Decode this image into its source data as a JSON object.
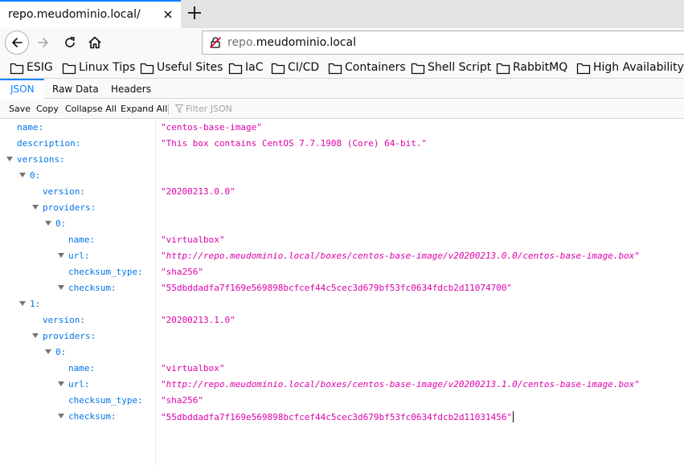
{
  "browser": {
    "tab_title": "repo.meudominio.local/",
    "url_prefix": "repo.",
    "url_host": "meudominio.local",
    "bookmarks": [
      "ESIG",
      "Linux Tips",
      "Useful Sites",
      "IaC",
      "CI/CD",
      "Containers",
      "Shell Script",
      "RabbitMQ",
      "High Availability"
    ]
  },
  "viewer": {
    "tabs": [
      "JSON",
      "Raw Data",
      "Headers"
    ],
    "actions": [
      "Save",
      "Copy",
      "Collapse All",
      "Expand All"
    ],
    "filter_placeholder": "Filter JSON"
  },
  "json": {
    "name": "centos-base-image",
    "description": "This box contains CentOS 7.7.1908 (Core) 64-bit.",
    "versions": [
      {
        "version": "20200213.0.0",
        "providers": [
          {
            "name": "virtualbox",
            "url": "http://repo.meudominio.local/boxes/centos-base-image/v20200213.0.0/centos-base-image.box",
            "checksum_type": "sha256",
            "checksum": "55dbddadfa7f169e569898bcfcef44c5cec3d679bf53fc0634fdcb2d11074700"
          }
        ]
      },
      {
        "version": "20200213.1.0",
        "providers": [
          {
            "name": "virtualbox",
            "url": "http://repo.meudominio.local/boxes/centos-base-image/v20200213.1.0/centos-base-image.box",
            "checksum_type": "sha256",
            "checksum": "55dbddadfa7f169e569898bcfcef44c5cec3d679bf53fc0634fdcb2d11031456"
          }
        ]
      }
    ]
  },
  "tree_rows": [
    {
      "key": "name:",
      "value": "\"centos-base-image\"",
      "level": 0,
      "expander": false
    },
    {
      "key": "description:",
      "value": "\"This box contains CentOS 7.7.1908 (Core) 64-bit.\"",
      "level": 0,
      "expander": false
    },
    {
      "key": "versions:",
      "value": "",
      "level": 0,
      "expander": true
    },
    {
      "key": "0:",
      "value": "",
      "level": 1,
      "expander": true
    },
    {
      "key": "version:",
      "value": "\"20200213.0.0\"",
      "level": 2,
      "expander": false
    },
    {
      "key": "providers:",
      "value": "",
      "level": 2,
      "expander": true
    },
    {
      "key": "0:",
      "value": "",
      "level": 3,
      "expander": true
    },
    {
      "key": "name:",
      "value": "\"virtualbox\"",
      "level": 4,
      "expander": false
    },
    {
      "key": "url:",
      "value": "\"http://repo.meudominio.local/boxes/centos-base-image/v20200213.0.0/centos-base-image.box\"",
      "level": 4,
      "expander": true,
      "is_url": true
    },
    {
      "key": "checksum_type:",
      "value": "\"sha256\"",
      "level": 4,
      "expander": false
    },
    {
      "key": "checksum:",
      "value": "\"55dbddadfa7f169e569898bcfcef44c5cec3d679bf53fc0634fdcb2d11074700\"",
      "level": 4,
      "expander": true
    },
    {
      "key": "1:",
      "value": "",
      "level": 1,
      "expander": true
    },
    {
      "key": "version:",
      "value": "\"20200213.1.0\"",
      "level": 2,
      "expander": false
    },
    {
      "key": "providers:",
      "value": "",
      "level": 2,
      "expander": true
    },
    {
      "key": "0:",
      "value": "",
      "level": 3,
      "expander": true
    },
    {
      "key": "name:",
      "value": "\"virtualbox\"",
      "level": 4,
      "expander": false
    },
    {
      "key": "url:",
      "value": "\"http://repo.meudominio.local/boxes/centos-base-image/v20200213.1.0/centos-base-image.box\"",
      "level": 4,
      "expander": true,
      "is_url": true
    },
    {
      "key": "checksum_type:",
      "value": "\"sha256\"",
      "level": 4,
      "expander": false
    },
    {
      "key": "checksum:",
      "value": "\"55dbddadfa7f169e569898bcfcef44c5cec3d679bf53fc0634fdcb2d11031456\"",
      "level": 4,
      "expander": true,
      "has_caret": true
    }
  ],
  "icons": {
    "tab_close": "close-icon",
    "new_tab": "plus-icon",
    "back": "arrow-left-icon",
    "forward": "arrow-right-icon",
    "reload": "reload-icon",
    "home": "home-icon",
    "insecure": "insecure-lock-icon",
    "bookmark": "folder-icon",
    "expander": "twisty-down-icon",
    "filter": "filter-icon"
  },
  "colors": {
    "accent": "#0a84ff",
    "json_key": "#0074e8",
    "json_string": "#dd00a9"
  }
}
